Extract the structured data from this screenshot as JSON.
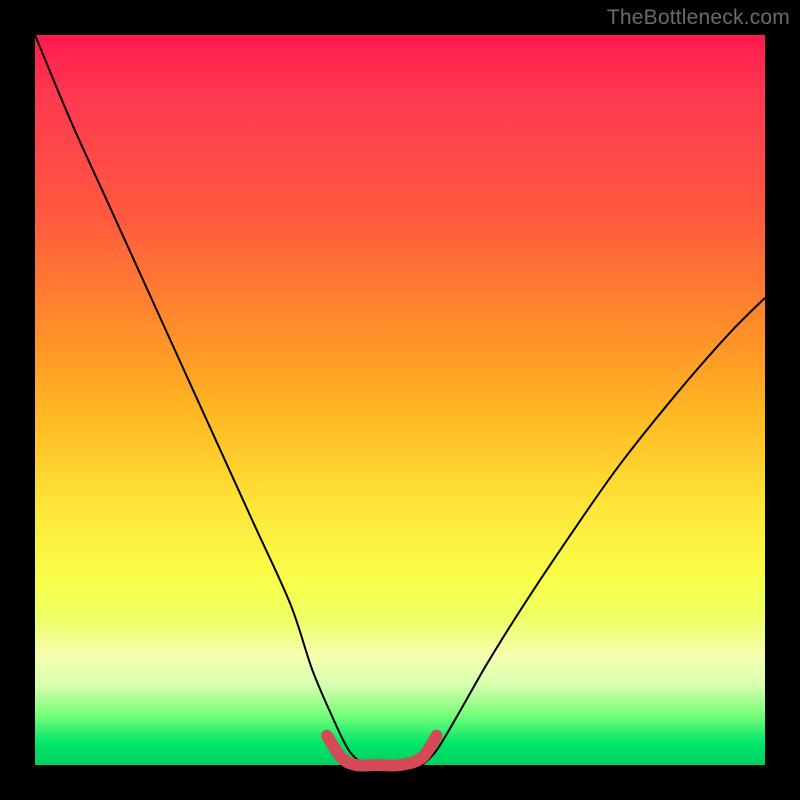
{
  "watermark": "TheBottleneck.com",
  "colors": {
    "frame": "#000000",
    "curve": "#000000",
    "highlight": "#d44a57"
  },
  "chart_data": {
    "type": "line",
    "title": "",
    "xlabel": "",
    "ylabel": "",
    "xlim": [
      0,
      100
    ],
    "ylim": [
      0,
      100
    ],
    "grid": false,
    "legend": false,
    "series": [
      {
        "name": "left-curve",
        "x": [
          0,
          5,
          10,
          15,
          20,
          25,
          30,
          35,
          38,
          41,
          43,
          45
        ],
        "values": [
          100,
          88,
          77,
          66,
          55,
          44,
          33,
          22,
          13,
          6,
          2,
          0
        ]
      },
      {
        "name": "right-curve",
        "x": [
          53,
          55,
          58,
          62,
          67,
          73,
          80,
          88,
          95,
          100
        ],
        "values": [
          0,
          2,
          7,
          14,
          22,
          31,
          41,
          51,
          59,
          64
        ]
      },
      {
        "name": "valley-highlight",
        "x": [
          40,
          42,
          44,
          47,
          50,
          53,
          55
        ],
        "values": [
          4,
          1,
          0,
          0,
          0,
          1,
          4
        ],
        "stroke": "#d44a57",
        "stroke_width": 12
      }
    ],
    "gradient_stops": [
      {
        "pct": 0,
        "color": "#ff1a4d"
      },
      {
        "pct": 25,
        "color": "#ff5a3f"
      },
      {
        "pct": 52,
        "color": "#ffb822"
      },
      {
        "pct": 75,
        "color": "#f7ff4a"
      },
      {
        "pct": 93,
        "color": "#7bff7b"
      },
      {
        "pct": 100,
        "color": "#00d060"
      }
    ]
  }
}
